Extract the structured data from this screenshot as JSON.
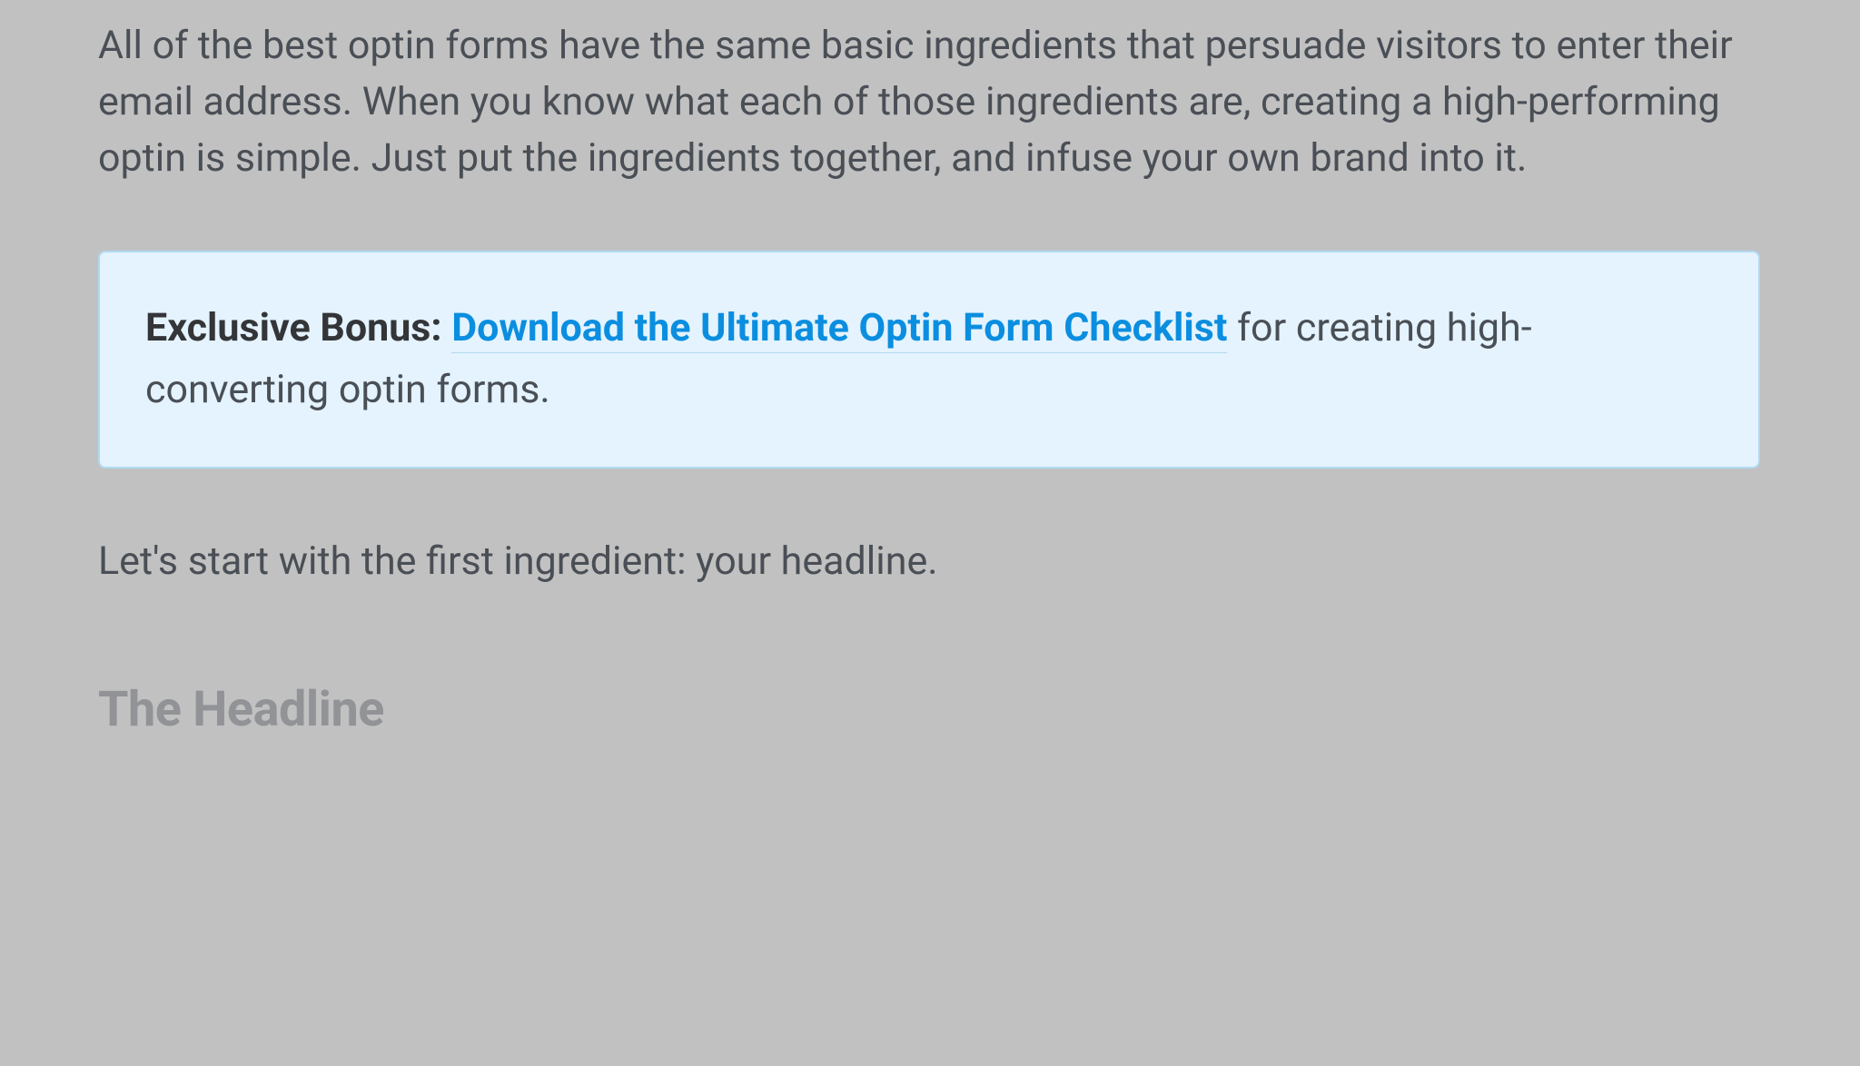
{
  "article": {
    "intro": "All of the best optin forms have the same basic ingredients that persuade visitors to enter their email address. When you know what each of those ingredients are, creating a high-performing optin is simple. Just put the ingredients together, and infuse your own brand into it.",
    "callout": {
      "bold_prefix": "Exclusive Bonus: ",
      "link_text": "Download the Ultimate Optin Form Checklist",
      "suffix": " for creating high-converting optin forms."
    },
    "transition": "Let's start with the first ingredient: your headline.",
    "heading": "The Headline"
  }
}
